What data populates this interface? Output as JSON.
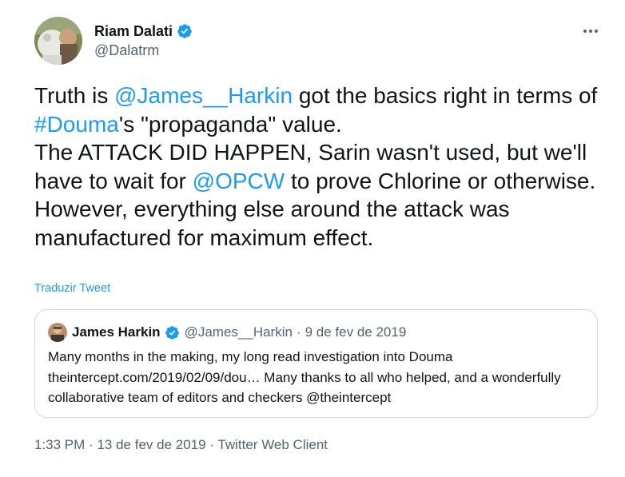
{
  "author": {
    "name": "Riam Dalati",
    "handle": "@Dalatrm",
    "verified": true
  },
  "more_icon": "more-horizontal-icon",
  "tweet": {
    "parts": [
      "Truth is ",
      "@James__Harkin",
      " got the basics right in terms of ",
      "#Douma",
      "'s \"propaganda\" value.",
      "The ATTACK DID HAPPEN, Sarin wasn't used, but we'll have to wait for ",
      "@OPCW",
      " to prove Chlorine or otherwise.",
      "However, everything else around the attack was manufactured for maximum effect."
    ]
  },
  "translate_label": "Traduzir Tweet",
  "quote": {
    "name": "James Harkin",
    "handle": "@James__Harkin",
    "separator": "·",
    "date": "9 de fev de 2019",
    "text": "Many months in the making, my long read investigation into Douma theintercept.com/2019/02/09/dou… Many thanks to all who helped, and a wonderfully collaborative team of editors and checkers @theintercept"
  },
  "footer": {
    "time": "1:33 PM",
    "sep1": "·",
    "date": "13 de fev de 2019",
    "sep2": "·",
    "client": "Twitter Web Client"
  },
  "colors": {
    "link": "#1d9bf0",
    "secondary_text": "#536471",
    "primary_text": "#0f1419",
    "border": "#cfd9de"
  }
}
